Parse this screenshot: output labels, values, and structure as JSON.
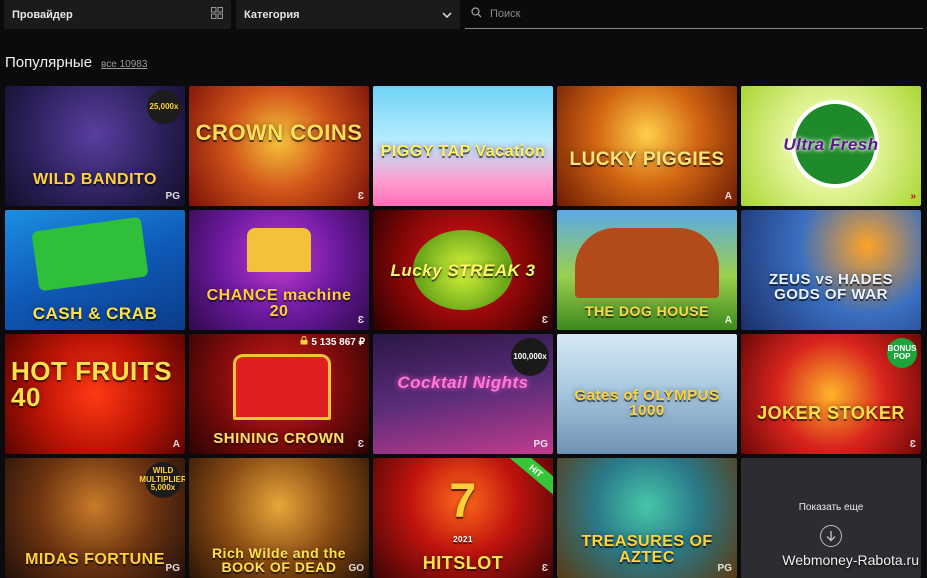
{
  "filters": {
    "provider_label": "Провайдер",
    "category_label": "Категория",
    "search_placeholder": "Поиск"
  },
  "section": {
    "title": "Популярные",
    "count_label": "все 10983"
  },
  "games": [
    {
      "title": "WILD BANDITO",
      "badge": "25,000x",
      "brand": "PG"
    },
    {
      "title": "CROWN COINS",
      "brand": "Ɛ"
    },
    {
      "title": "PIGGY TAP Vacation",
      "brand": ""
    },
    {
      "title": "LUCKY PIGGIES",
      "brand": "A"
    },
    {
      "title": "Ultra Fresh",
      "brand": "»"
    },
    {
      "title": "CASH & CRAB",
      "brand": ""
    },
    {
      "title": "CHANCE machine 20",
      "brand": "Ɛ"
    },
    {
      "title": "Lucky STREAK 3",
      "brand": "Ɛ"
    },
    {
      "title": "THE DOG HOUSE",
      "brand": "A"
    },
    {
      "title": "ZEUS vs HADES GODS OF WAR",
      "brand": ""
    },
    {
      "title": "HOT FRUITS 40",
      "brand": "A"
    },
    {
      "title": "SHINING CROWN",
      "jackpot": "5 135 867 ₽",
      "brand": "Ɛ"
    },
    {
      "title": "Cocktail Nights",
      "badge": "100,000x",
      "brand": "PG"
    },
    {
      "title": "Gates of OLYMPUS 1000",
      "brand": ""
    },
    {
      "title": "JOKER STOKER",
      "badge": "BONUS POP",
      "brand": "Ɛ"
    },
    {
      "title": "MIDAS FORTUNE",
      "badge": "WILD MULTIPLIER 5,000x",
      "brand": "PG"
    },
    {
      "title": "Rich Wilde and the BOOK OF DEAD",
      "brand": "GO"
    },
    {
      "title": "HITSLOT",
      "ribbon": "HIT",
      "year": "2021",
      "brand": "Ɛ"
    },
    {
      "title": "TREASURES OF AZTEC",
      "brand": "PG"
    }
  ],
  "show_more": {
    "label": "Показать еще"
  },
  "watermark": "Webmoney-Rabota.ru"
}
